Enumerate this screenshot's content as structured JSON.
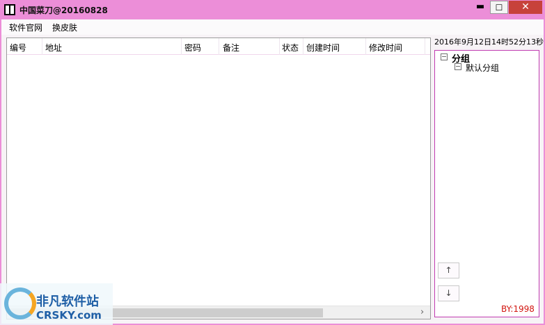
{
  "window": {
    "title": "中国菜刀@20160828",
    "minimize_glyph": "▬",
    "maximize_glyph": "☐",
    "close_glyph": "✕",
    "accent_color": "#ec8ed8"
  },
  "menubar": {
    "items": [
      "软件官网",
      "换皮肤"
    ]
  },
  "grid": {
    "columns": [
      "编号",
      "地址",
      "密码",
      "备注",
      "状态",
      "创建时间",
      "修改时间"
    ],
    "rows": [],
    "scroll_right_glyph": "›"
  },
  "clock": {
    "text": "2016年9月12日14时52分13秒"
  },
  "tree": {
    "root_label": "分组",
    "children": [
      "默认分组"
    ]
  },
  "buttons": {
    "up_glyph": "↑",
    "down_glyph": "↓"
  },
  "footer": {
    "by_label": "BY:1998"
  },
  "watermark": {
    "cn_text": "非凡软件站",
    "en_text": "CRSKY.com"
  }
}
